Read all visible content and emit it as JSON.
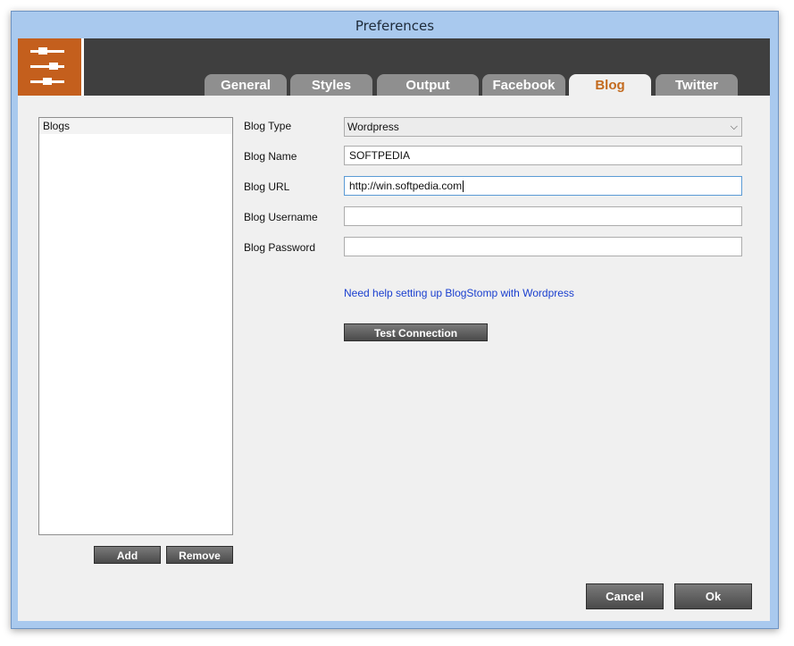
{
  "window": {
    "title": "Preferences"
  },
  "tabs": [
    {
      "label": "General",
      "active": false
    },
    {
      "label": "Styles",
      "active": false
    },
    {
      "label": "Output",
      "active": false
    },
    {
      "label": "Facebook",
      "active": false
    },
    {
      "label": "Blog",
      "active": true
    },
    {
      "label": "Twitter",
      "active": false
    }
  ],
  "blogs_list": {
    "header": "Blogs",
    "items": []
  },
  "list_buttons": {
    "add": "Add",
    "remove": "Remove"
  },
  "form": {
    "blog_type": {
      "label": "Blog Type",
      "value": "Wordpress"
    },
    "blog_name": {
      "label": "Blog Name",
      "value": "SOFTPEDIA"
    },
    "blog_url": {
      "label": "Blog URL",
      "value": "http://win.softpedia.com"
    },
    "blog_username": {
      "label": "Blog Username",
      "value": ""
    },
    "blog_password": {
      "label": "Blog Password",
      "value": ""
    }
  },
  "help_link": "Need help setting up BlogStomp with Wordpress",
  "test_connection": "Test Connection",
  "footer": {
    "cancel": "Cancel",
    "ok": "Ok"
  },
  "colors": {
    "accent": "#c45f1d",
    "header": "#3f3f3f",
    "active_tab_text": "#c36a1e",
    "link": "#1a3fcf"
  },
  "icons": {
    "app_logo": "sliders-icon",
    "dropdown": "chevron-down-icon"
  }
}
